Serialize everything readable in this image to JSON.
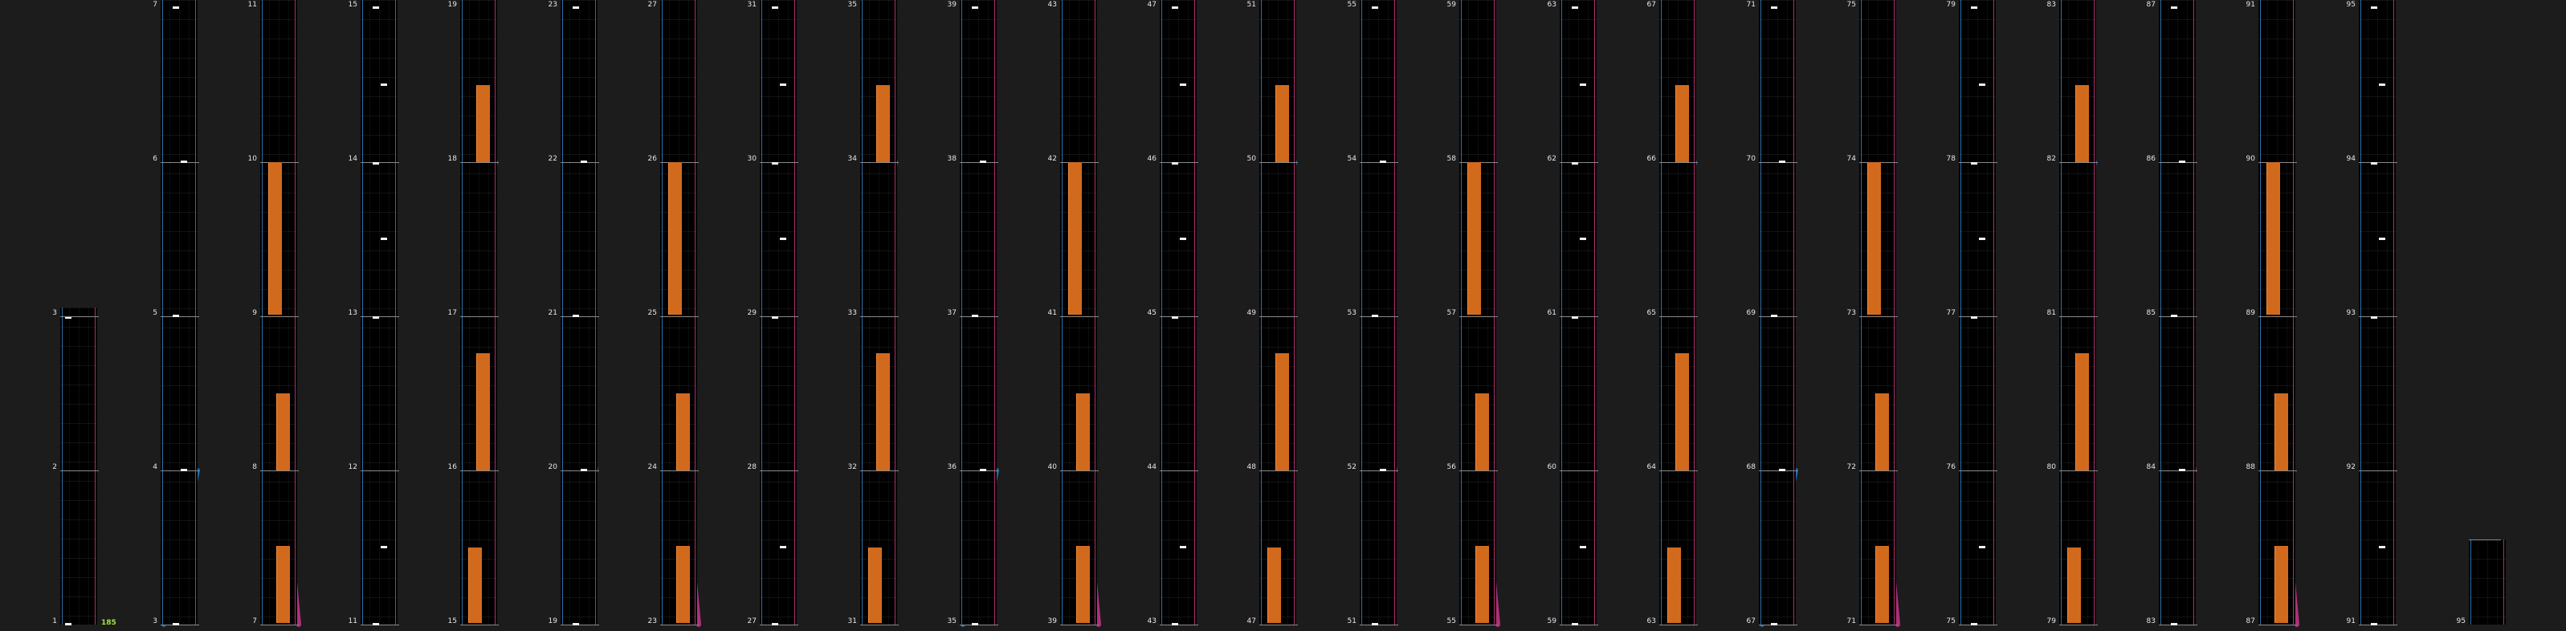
{
  "colors": {
    "background": "#1c1c1c",
    "cell": "#000000",
    "blue_trail": "#1e6fb0",
    "pink_trail": "#b0307a",
    "orange_bar": "#d26a1e",
    "counter": "#9fe33c"
  },
  "counter": "185",
  "labels": {
    "c0": [
      "1",
      "2",
      "3"
    ],
    "grid": [
      [
        "3",
        "4",
        "5",
        "6",
        "7"
      ],
      [
        "7",
        "8",
        "9",
        "10",
        "11"
      ],
      [
        "11",
        "12",
        "13",
        "14",
        "15"
      ],
      [
        "15",
        "16",
        "17",
        "18",
        "19"
      ],
      [
        "19",
        "20",
        "21",
        "22",
        "23"
      ],
      [
        "23",
        "24",
        "25",
        "26",
        "27"
      ],
      [
        "27",
        "28",
        "29",
        "30",
        "31"
      ],
      [
        "31",
        "32",
        "33",
        "34",
        "35"
      ],
      [
        "35",
        "36",
        "37",
        "38",
        "39"
      ],
      [
        "39",
        "40",
        "41",
        "42",
        "43"
      ],
      [
        "43",
        "44",
        "45",
        "46",
        "47"
      ],
      [
        "47",
        "48",
        "49",
        "50",
        "51"
      ],
      [
        "51",
        "52",
        "53",
        "54",
        "55"
      ],
      [
        "55",
        "56",
        "57",
        "58",
        "59"
      ],
      [
        "59",
        "60",
        "61",
        "62",
        "63"
      ],
      [
        "63",
        "64",
        "65",
        "66",
        "67"
      ],
      [
        "67",
        "68",
        "69",
        "70",
        "71"
      ],
      [
        "71",
        "72",
        "73",
        "74",
        "75"
      ],
      [
        "75",
        "76",
        "77",
        "78",
        "79"
      ],
      [
        "79",
        "80",
        "81",
        "82",
        "83"
      ],
      [
        "83",
        "84",
        "85",
        "86",
        "87"
      ],
      [
        "87",
        "88",
        "89",
        "90",
        "91"
      ],
      [
        "91",
        "92",
        "93",
        "94",
        "95"
      ]
    ],
    "last": "95"
  }
}
